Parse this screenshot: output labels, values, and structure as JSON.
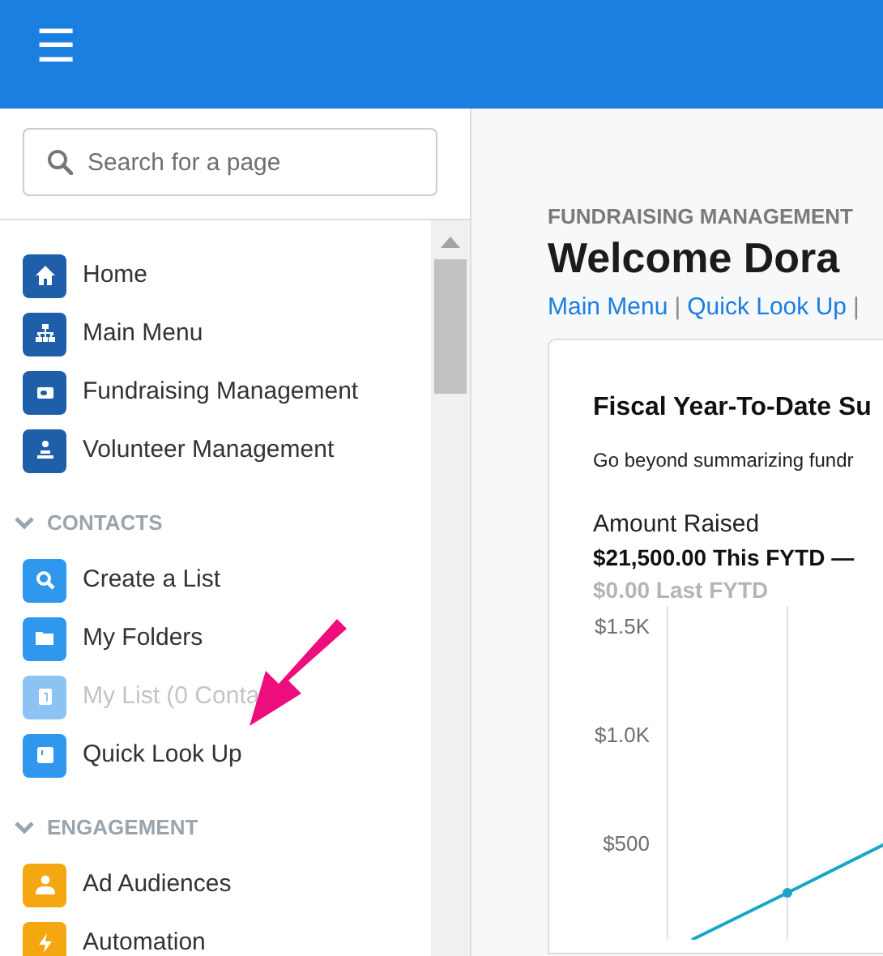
{
  "top_bar": {
    "menu_icon": "☰"
  },
  "sidebar": {
    "search": {
      "placeholder": "Search for a page"
    },
    "groups": [
      {
        "items": [
          {
            "label": "Home",
            "color": "#1f5ea8",
            "disabled": false
          },
          {
            "label": "Main Menu",
            "color": "#1f5ea8",
            "disabled": false
          },
          {
            "label": "Fundraising Management",
            "color": "#1f5ea8",
            "disabled": false
          },
          {
            "label": "Volunteer Management",
            "color": "#1f5ea8",
            "disabled": false
          }
        ]
      },
      {
        "heading": "CONTACTS",
        "expanded": true,
        "items": [
          {
            "label": "Create a List",
            "color": "#3097ee",
            "disabled": false
          },
          {
            "label": "My Folders",
            "color": "#3097ee",
            "disabled": false
          },
          {
            "label": "My List (0 Conta",
            "color": "#8cc3f2",
            "disabled": true
          },
          {
            "label": "Quick Look Up",
            "color": "#3097ee",
            "disabled": false
          }
        ]
      },
      {
        "heading": "ENGAGEMENT",
        "expanded": true,
        "items": [
          {
            "label": "Ad Audiences",
            "color": "#f5a712",
            "disabled": false
          },
          {
            "label": "Automation",
            "color": "#f5a712",
            "disabled": false
          }
        ]
      }
    ]
  },
  "main": {
    "section": "FUNDRAISING MANAGEMENT",
    "title": "Welcome Dora",
    "links": [
      {
        "kind": "link",
        "text": "Main Menu"
      },
      {
        "kind": "separator",
        "text": "|"
      },
      {
        "kind": "link",
        "text": "Quick Look Up"
      },
      {
        "kind": "separator",
        "text": "|"
      }
    ],
    "card": {
      "title": "Fiscal Year-To-Date Su",
      "description": "Go beyond summarizing fundr",
      "metric": {
        "label": "Amount Raised",
        "current": "$21,500.00 This FYTD —",
        "previous": "$0.00 Last FYTD"
      },
      "chart": {
        "y_labels": [
          "$1.5K",
          "$1.0K",
          "$500"
        ]
      }
    }
  }
}
